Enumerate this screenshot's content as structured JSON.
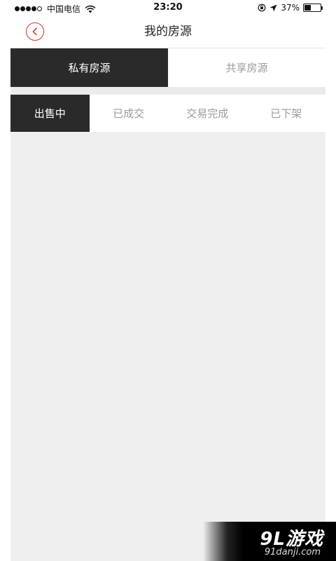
{
  "status_bar": {
    "carrier": "中国电信",
    "time": "23:20",
    "battery_percent": "37%",
    "battery_level": 0.37
  },
  "header": {
    "title": "我的房源"
  },
  "main_tabs": [
    {
      "label": "私有房源",
      "active": true
    },
    {
      "label": "共享房源",
      "active": false
    }
  ],
  "sub_tabs": [
    {
      "label": "出售中",
      "active": true
    },
    {
      "label": "已成交",
      "active": false
    },
    {
      "label": "交易完成",
      "active": false
    },
    {
      "label": "已下架",
      "active": false
    }
  ],
  "watermark": {
    "logo": "9L游戏",
    "domain": "91danji.com"
  },
  "colors": {
    "accent": "#d0342c",
    "tab_active_bg": "#2b2a2a",
    "content_bg": "#efefef"
  }
}
